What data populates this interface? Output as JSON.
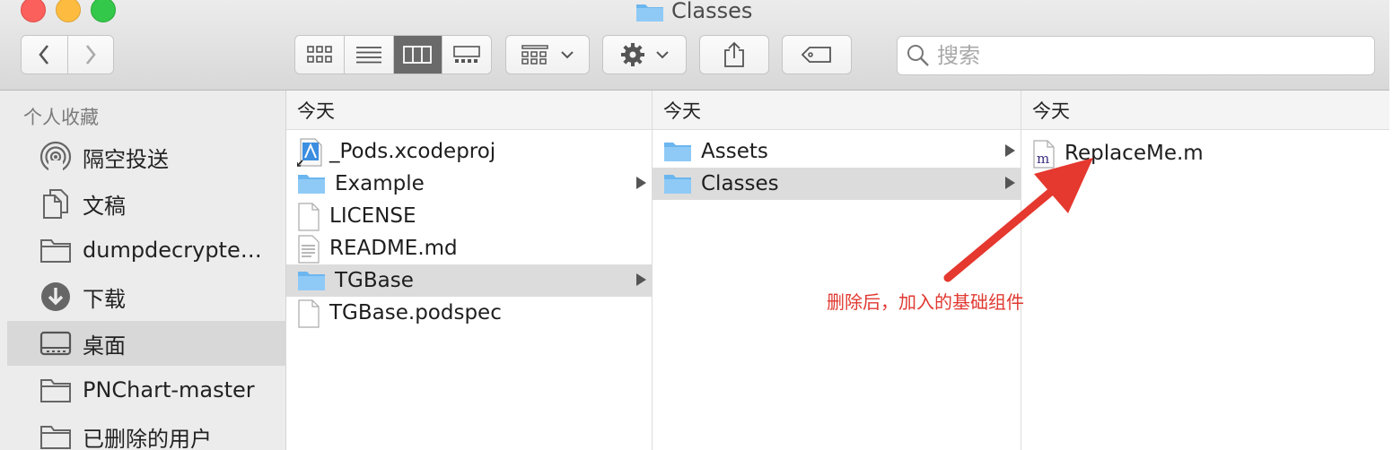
{
  "window": {
    "title": "Classes"
  },
  "toolbar": {
    "back_icon": "chevron-left-icon",
    "forward_icon": "chevron-right-icon",
    "view_modes": [
      "icon-view-icon",
      "list-view-icon",
      "column-view-icon",
      "gallery-view-icon"
    ],
    "active_view": "column-view-icon",
    "group_icon": "group-grid-icon",
    "action_icon": "gear-icon",
    "share_icon": "share-icon",
    "tag_icon": "tag-icon",
    "search_placeholder": "搜索"
  },
  "sidebar": {
    "heading": "个人收藏",
    "items": [
      {
        "label": "隔空投送",
        "icon": "airdrop-icon",
        "selected": false
      },
      {
        "label": "文稿",
        "icon": "documents-icon",
        "selected": false
      },
      {
        "label": "dumpdecrypte…",
        "icon": "folder-icon",
        "selected": false
      },
      {
        "label": "下载",
        "icon": "download-icon",
        "selected": false
      },
      {
        "label": "桌面",
        "icon": "desktop-icon",
        "selected": true
      },
      {
        "label": "PNChart-master",
        "icon": "folder-icon",
        "selected": false
      },
      {
        "label": "已删除的用户",
        "icon": "folder-icon",
        "selected": false
      }
    ]
  },
  "columns": [
    {
      "header": "今天",
      "items": [
        {
          "name": "_Pods.xcodeproj",
          "type": "xcodeproj",
          "selected": false,
          "has_children": false
        },
        {
          "name": "Example",
          "type": "folder",
          "selected": false,
          "has_children": true
        },
        {
          "name": "LICENSE",
          "type": "file",
          "selected": false,
          "has_children": false
        },
        {
          "name": "README.md",
          "type": "textfile",
          "selected": false,
          "has_children": false
        },
        {
          "name": "TGBase",
          "type": "folder",
          "selected": true,
          "has_children": true
        },
        {
          "name": "TGBase.podspec",
          "type": "file",
          "selected": false,
          "has_children": false
        }
      ]
    },
    {
      "header": "今天",
      "items": [
        {
          "name": "Assets",
          "type": "folder",
          "selected": false,
          "has_children": true
        },
        {
          "name": "Classes",
          "type": "folder",
          "selected": true,
          "has_children": true
        }
      ]
    },
    {
      "header": "今天",
      "items": [
        {
          "name": "ReplaceMe.m",
          "type": "objc-source",
          "selected": false,
          "has_children": false
        }
      ]
    }
  ],
  "annotation": {
    "text": "删除后，加入的基础组件",
    "color": "#e03a32"
  }
}
